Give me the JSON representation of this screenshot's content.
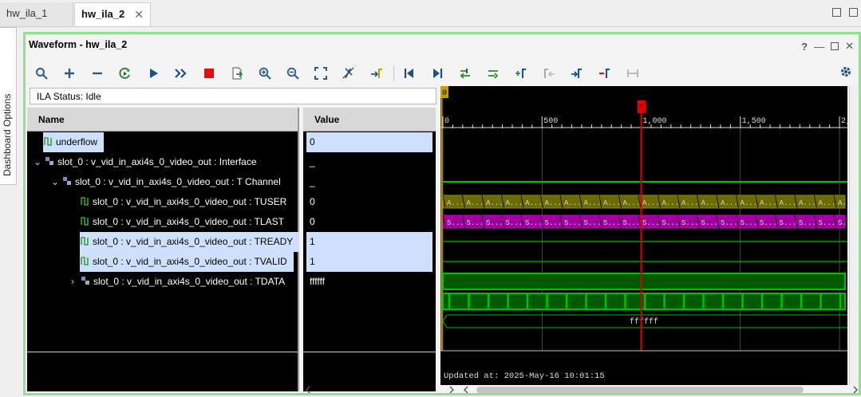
{
  "tabs": [
    {
      "label": "hw_ila_1",
      "active": false
    },
    {
      "label": "hw_ila_2",
      "active": true
    }
  ],
  "sidebar": {
    "label": "Dashboard Options"
  },
  "panel": {
    "title": "Waveform - hw_ila_2"
  },
  "status": {
    "label": "ILA Status:",
    "value": "Idle"
  },
  "columns": {
    "name": "Name",
    "value": "Value"
  },
  "rows": [
    {
      "name": "underflow",
      "value": "0",
      "selected": true
    },
    {
      "name": "slot_0 : v_vid_in_axi4s_0_video_out : Interface",
      "value": "_",
      "selected": false
    },
    {
      "name": "slot_0 : v_vid_in_axi4s_0_video_out : T Channel",
      "value": "_",
      "selected": false
    },
    {
      "name": "slot_0 : v_vid_in_axi4s_0_video_out : TUSER",
      "value": "0",
      "selected": false
    },
    {
      "name": "slot_0 : v_vid_in_axi4s_0_video_out : TLAST",
      "value": "0",
      "selected": false
    },
    {
      "name": "slot_0 : v_vid_in_axi4s_0_video_out : TREADY",
      "value": "1",
      "selected": true
    },
    {
      "name": "slot_0 : v_vid_in_axi4s_0_video_out : TVALID",
      "value": "1",
      "selected": true
    },
    {
      "name": "slot_0 : v_vid_in_axi4s_0_video_out : TDATA",
      "value": "ffffff",
      "selected": false
    }
  ],
  "wave": {
    "ticks": [
      "0",
      "500",
      "1,000",
      "1,500",
      "2,"
    ],
    "marker_0": "0",
    "marker_t": "T",
    "interface_label": "A...",
    "tchannel_label": "S...",
    "tdata_value": "ffffff",
    "updated": "Updated at: 2025-May-16 10:01:15"
  },
  "colors": {
    "green": "#00c000",
    "olive": "#6b6b00",
    "magenta": "#a000a0",
    "trigger": "#e00000"
  }
}
